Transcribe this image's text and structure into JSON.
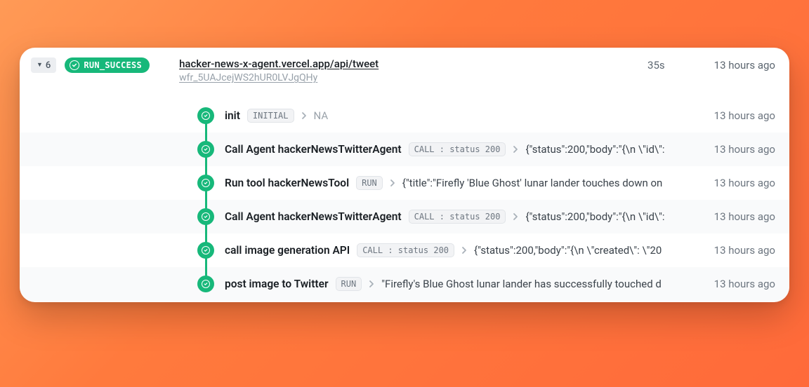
{
  "header": {
    "count": "6",
    "status_label": "RUN_SUCCESS",
    "url": "hacker-news-x-agent.vercel.app/api/tweet",
    "run_id": "wfr_5UAJcejWS2hUR0LVJgQHy",
    "duration": "35s",
    "age": "13 hours ago"
  },
  "steps": [
    {
      "name": "init",
      "badge": "INITIAL",
      "output": "NA",
      "output_na": true,
      "time": "13 hours ago"
    },
    {
      "name": "Call Agent hackerNewsTwitterAgent",
      "badge": "CALL : status 200",
      "output": "{\"status\":200,\"body\":\"{\\n \\\"id\\\":",
      "time": "13 hours ago"
    },
    {
      "name": "Run tool hackerNewsTool",
      "badge": "RUN",
      "output": "{\"title\":\"Firefly 'Blue Ghost' lunar lander touches down on",
      "time": "13 hours ago"
    },
    {
      "name": "Call Agent hackerNewsTwitterAgent",
      "badge": "CALL : status 200",
      "output": "{\"status\":200,\"body\":\"{\\n \\\"id\\\":",
      "time": "13 hours ago"
    },
    {
      "name": "call image generation API",
      "badge": "CALL : status 200",
      "output": "{\"status\":200,\"body\":\"{\\n \\\"created\\\": \\\"20",
      "time": "13 hours ago"
    },
    {
      "name": "post image to Twitter",
      "badge": "RUN",
      "output": "\"Firefly's Blue Ghost lunar lander has successfully touched d",
      "time": "13 hours ago"
    }
  ]
}
